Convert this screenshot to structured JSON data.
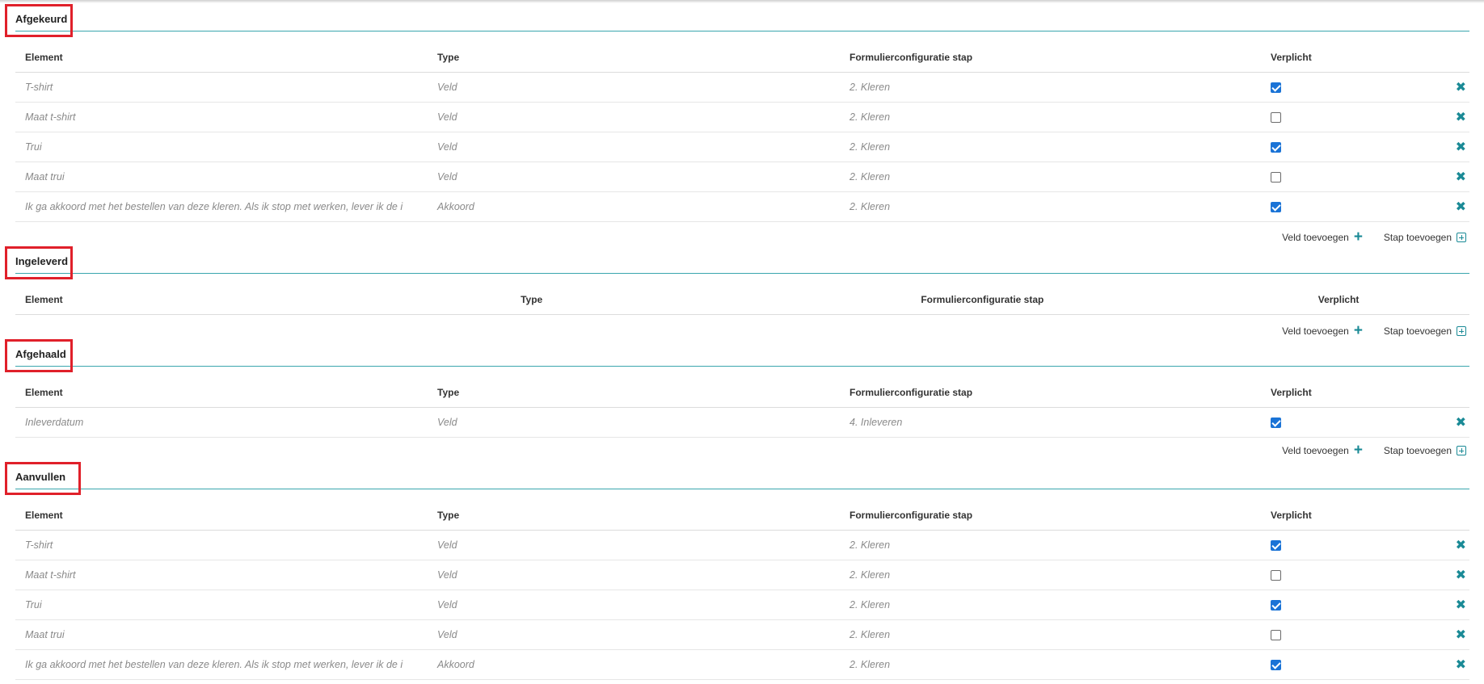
{
  "columns": {
    "element": "Element",
    "type": "Type",
    "step": "Formulierconfiguratie stap",
    "required": "Verplicht"
  },
  "actions": {
    "add_field": "Veld toevoegen",
    "add_step": "Stap toevoegen"
  },
  "sections": {
    "afgekeurd": {
      "title": "Afgekeurd",
      "rows": [
        {
          "element": "T-shirt",
          "type": "Veld",
          "step": "2. Kleren",
          "required": true
        },
        {
          "element": "Maat t-shirt",
          "type": "Veld",
          "step": "2. Kleren",
          "required": false
        },
        {
          "element": "Trui",
          "type": "Veld",
          "step": "2. Kleren",
          "required": true
        },
        {
          "element": "Maat trui",
          "type": "Veld",
          "step": "2. Kleren",
          "required": false
        },
        {
          "element": "Ik ga akkoord met het bestellen van deze kleren. Als ik stop met werken, lever ik de i",
          "type": "Akkoord",
          "step": "2. Kleren",
          "required": true
        }
      ]
    },
    "ingeleverd": {
      "title": "Ingeleverd",
      "rows": []
    },
    "afgehaald": {
      "title": "Afgehaald",
      "rows": [
        {
          "element": "Inleverdatum",
          "type": "Veld",
          "step": "4. Inleveren",
          "required": true
        }
      ]
    },
    "aanvullen": {
      "title": "Aanvullen",
      "rows": [
        {
          "element": "T-shirt",
          "type": "Veld",
          "step": "2. Kleren",
          "required": true
        },
        {
          "element": "Maat t-shirt",
          "type": "Veld",
          "step": "2. Kleren",
          "required": false
        },
        {
          "element": "Trui",
          "type": "Veld",
          "step": "2. Kleren",
          "required": true
        },
        {
          "element": "Maat trui",
          "type": "Veld",
          "step": "2. Kleren",
          "required": false
        },
        {
          "element": "Ik ga akkoord met het bestellen van deze kleren. Als ik stop met werken, lever ik de i",
          "type": "Akkoord",
          "step": "2. Kleren",
          "required": true
        }
      ]
    }
  },
  "colors": {
    "accent": "#3aa6ae",
    "icon": "#1a8a96",
    "highlight": "#e0202a",
    "checkbox": "#1a73d6"
  },
  "icons": {
    "delete": "close-icon",
    "add_field": "plus-icon",
    "add_step": "plus-square-icon"
  }
}
